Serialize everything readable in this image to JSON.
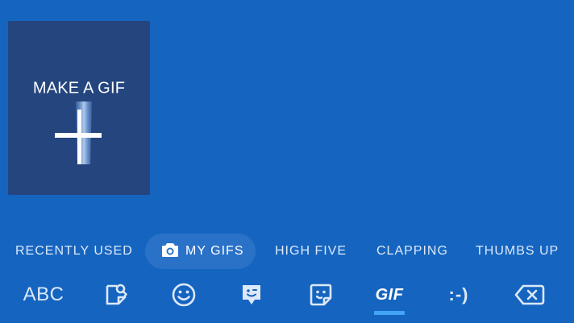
{
  "make_gif": {
    "label": "MAKE A GIF",
    "icon": "plus-icon"
  },
  "categories": [
    {
      "label": "RECENTLY USED",
      "active": false
    },
    {
      "label": "MY GIFS",
      "active": true,
      "icon": "camera-icon"
    },
    {
      "label": "HIGH FIVE",
      "active": false
    },
    {
      "label": "CLAPPING",
      "active": false
    },
    {
      "label": "THUMBS UP",
      "active": false
    }
  ],
  "keyboard_bar": {
    "abc_label": "ABC",
    "keys": [
      {
        "name": "abc",
        "icon": null
      },
      {
        "name": "search-sticker",
        "icon": "search-sticker-icon"
      },
      {
        "name": "emoji",
        "icon": "smiley-icon"
      },
      {
        "name": "bitmoji",
        "icon": "bitmoji-icon"
      },
      {
        "name": "stickers",
        "icon": "sticker-icon"
      },
      {
        "name": "gif",
        "icon": null
      },
      {
        "name": "emoticons",
        "icon": null
      },
      {
        "name": "backspace",
        "icon": "backspace-icon"
      }
    ],
    "gif_label": "GIF",
    "emoticon_label": ":-)",
    "selected": "gif"
  },
  "colors": {
    "background": "#1565c0",
    "tile": "#24457e",
    "active_chip": "#2a71c8",
    "selected_indicator": "#42a5f5"
  }
}
